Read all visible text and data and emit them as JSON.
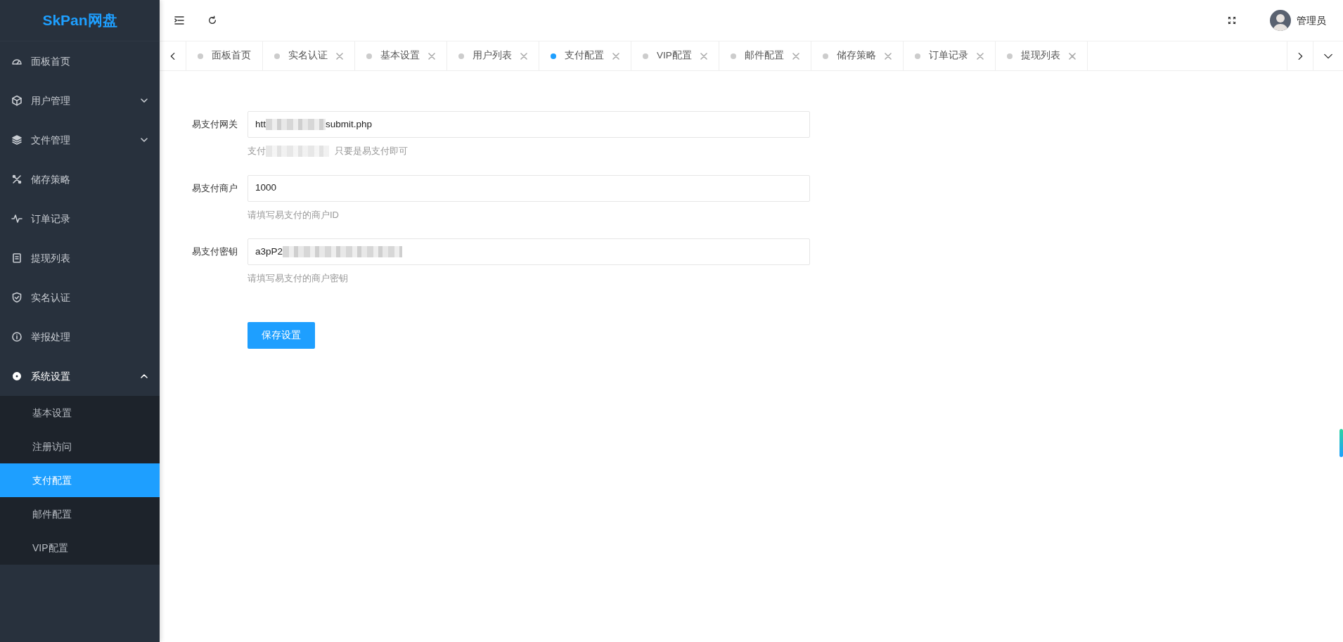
{
  "sidebar": {
    "logo": "SkPan网盘",
    "items": [
      {
        "label": "面板首页",
        "kind": "link",
        "expanded": false
      },
      {
        "label": "用户管理",
        "kind": "group",
        "expanded": false
      },
      {
        "label": "文件管理",
        "kind": "group",
        "expanded": false
      },
      {
        "label": "储存策略",
        "kind": "link",
        "expanded": false
      },
      {
        "label": "订单记录",
        "kind": "link",
        "expanded": false
      },
      {
        "label": "提现列表",
        "kind": "link",
        "expanded": false
      },
      {
        "label": "实名认证",
        "kind": "link",
        "expanded": false
      },
      {
        "label": "举报处理",
        "kind": "link",
        "expanded": false
      },
      {
        "label": "系统设置",
        "kind": "group",
        "expanded": true,
        "children": [
          {
            "label": "基本设置",
            "selected": false
          },
          {
            "label": "注册访问",
            "selected": false
          },
          {
            "label": "支付配置",
            "selected": true
          },
          {
            "label": "邮件配置",
            "selected": false
          },
          {
            "label": "VIP配置",
            "selected": false
          }
        ]
      }
    ]
  },
  "header": {
    "user": "管理员"
  },
  "tabs": [
    {
      "label": "面板首页",
      "selected": false,
      "kind": "fixed"
    },
    {
      "label": "实名认证",
      "selected": false,
      "kind": "closable"
    },
    {
      "label": "基本设置",
      "selected": false,
      "kind": "closable"
    },
    {
      "label": "用户列表",
      "selected": false,
      "kind": "closable"
    },
    {
      "label": "支付配置",
      "selected": true,
      "kind": "closable"
    },
    {
      "label": "VIP配置",
      "selected": false,
      "kind": "closable"
    },
    {
      "label": "邮件配置",
      "selected": false,
      "kind": "closable"
    },
    {
      "label": "储存策略",
      "selected": false,
      "kind": "closable"
    },
    {
      "label": "订单记录",
      "selected": false,
      "kind": "closable"
    },
    {
      "label": "提现列表",
      "selected": false,
      "kind": "closable"
    }
  ],
  "form": {
    "fields": [
      {
        "label": "易支付网关",
        "value_start": "htt",
        "value_end": "submit.php",
        "value_redacted": true,
        "help_start": "支付",
        "help_end": "只要是易支付即可",
        "help_redacted": true
      },
      {
        "label": "易支付商户",
        "value_start": "1000",
        "value_redacted": false,
        "help_start": "请填写易支付的商户ID",
        "help_redacted": false
      },
      {
        "label": "易支付密钥",
        "value_start": "a3pP2",
        "value_redacted": true,
        "help_start": "请填写易支付的商户密钥",
        "help_redacted": false
      }
    ],
    "submit": "保存设置"
  }
}
